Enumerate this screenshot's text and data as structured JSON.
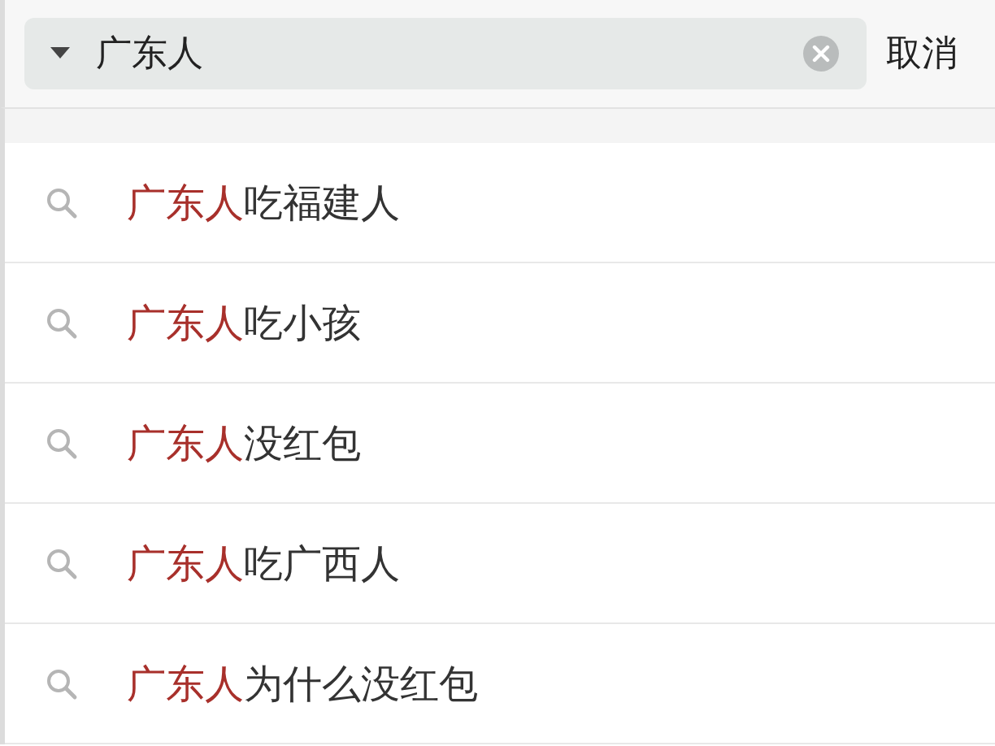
{
  "search": {
    "query": "广东人",
    "cancel": "取消"
  },
  "suggestions": [
    {
      "match": "广东人",
      "rest": "吃福建人"
    },
    {
      "match": "广东人",
      "rest": "吃小孩"
    },
    {
      "match": "广东人",
      "rest": "没红包"
    },
    {
      "match": "广东人",
      "rest": "吃广西人"
    },
    {
      "match": "广东人",
      "rest": "为什么没红包"
    }
  ]
}
